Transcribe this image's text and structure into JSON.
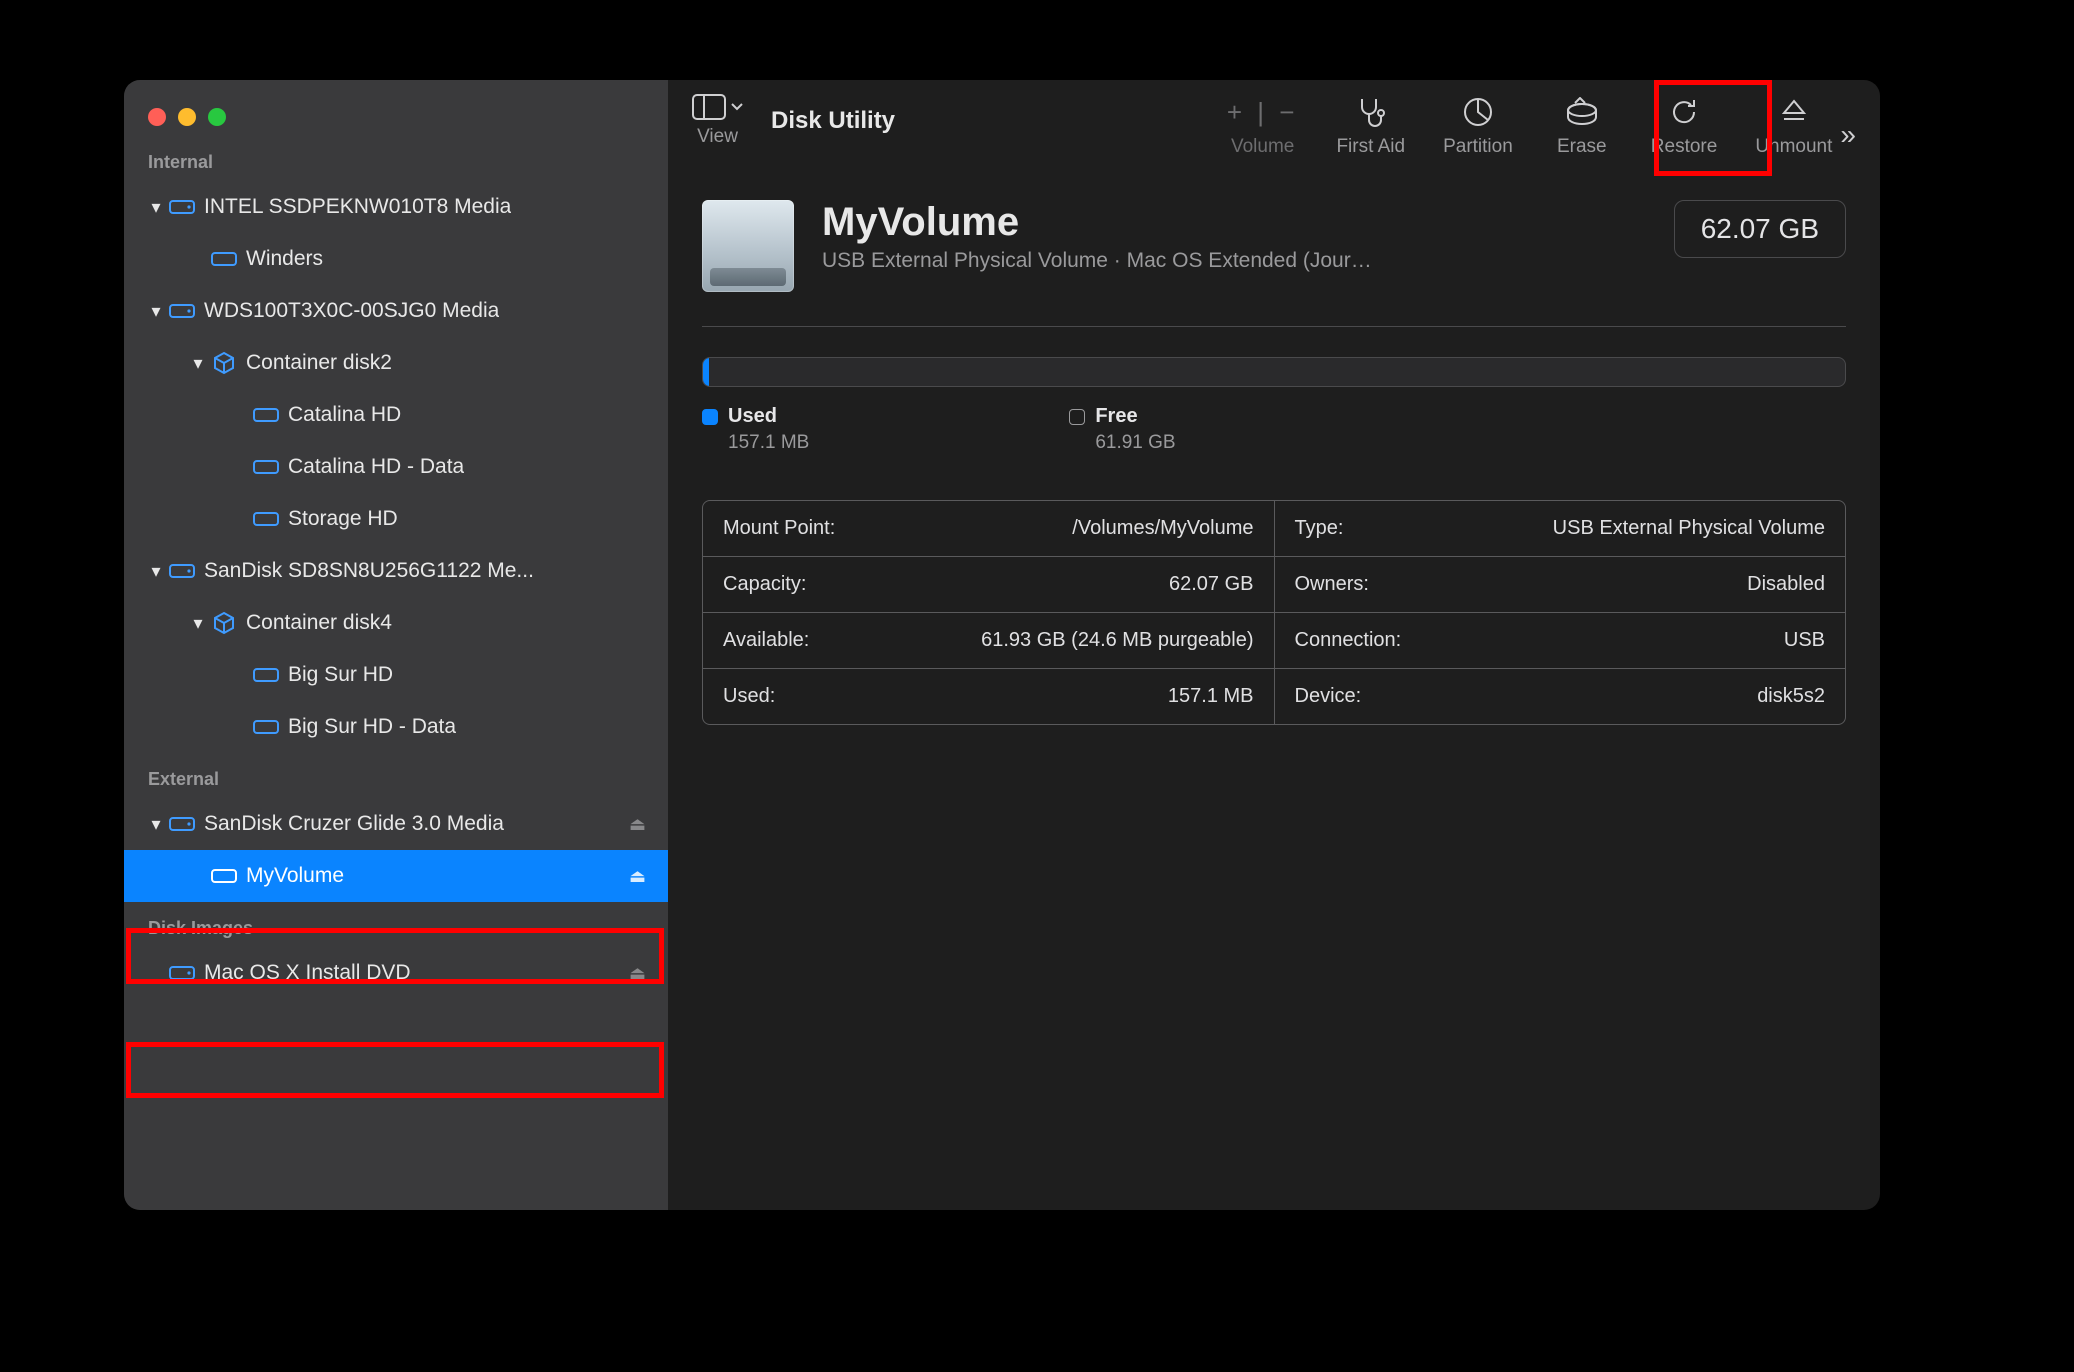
{
  "app_title": "Disk Utility",
  "toolbar": {
    "view_label": "View",
    "volume_label": "Volume",
    "first_aid_label": "First Aid",
    "partition_label": "Partition",
    "erase_label": "Erase",
    "restore_label": "Restore",
    "unmount_label": "Unmount"
  },
  "sidebar": {
    "internal_label": "Internal",
    "external_label": "External",
    "diskimages_label": "Disk Images",
    "internal": [
      {
        "label": "INTEL SSDPEKNW010T8 Media",
        "children": [
          {
            "label": "Winders"
          }
        ]
      },
      {
        "label": "WDS100T3X0C-00SJG0 Media",
        "children": [
          {
            "label": "Container disk2",
            "container": true,
            "children": [
              {
                "label": "Catalina HD"
              },
              {
                "label": "Catalina HD - Data"
              },
              {
                "label": "Storage HD"
              }
            ]
          }
        ]
      },
      {
        "label": "SanDisk SD8SN8U256G1122 Me...",
        "children": [
          {
            "label": "Container disk4",
            "container": true,
            "children": [
              {
                "label": "Big Sur HD"
              },
              {
                "label": "Big Sur HD - Data"
              }
            ]
          }
        ]
      }
    ],
    "external": [
      {
        "label": "SanDisk Cruzer Glide 3.0 Media",
        "eject": true,
        "children": [
          {
            "label": "MyVolume",
            "selected": true,
            "eject": true
          }
        ]
      }
    ],
    "diskimages": [
      {
        "label": "Mac OS X Install DVD",
        "eject": true
      }
    ]
  },
  "volume": {
    "name": "MyVolume",
    "subtitle": "USB External Physical Volume · Mac OS Extended (Jour…",
    "size": "62.07 GB",
    "used_label": "Used",
    "used_value": "157.1 MB",
    "free_label": "Free",
    "free_value": "61.91 GB"
  },
  "info": {
    "left": [
      {
        "k": "Mount Point:",
        "v": "/Volumes/MyVolume"
      },
      {
        "k": "Capacity:",
        "v": "62.07 GB"
      },
      {
        "k": "Available:",
        "v": "61.93 GB (24.6 MB purgeable)"
      },
      {
        "k": "Used:",
        "v": "157.1 MB"
      }
    ],
    "right": [
      {
        "k": "Type:",
        "v": "USB External Physical Volume"
      },
      {
        "k": "Owners:",
        "v": "Disabled"
      },
      {
        "k": "Connection:",
        "v": "USB"
      },
      {
        "k": "Device:",
        "v": "disk5s2"
      }
    ]
  }
}
